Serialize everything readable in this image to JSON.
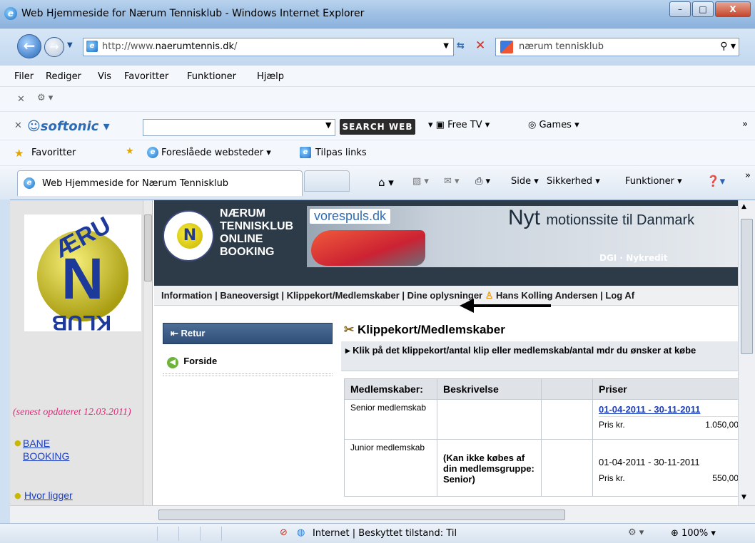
{
  "window": {
    "title": "Web Hjemmeside for Nærum Tennisklub - Windows Internet Explorer",
    "min": "–",
    "max": "□",
    "close": "X"
  },
  "address": {
    "prefix": "http://www.",
    "domain": "naerumtennis.dk",
    "suffix": "/",
    "search": "nærum tennisklub"
  },
  "menu": [
    "Filer",
    "Rediger",
    "Vis",
    "Favoritter",
    "Funktioner",
    "Hjælp"
  ],
  "softonic": {
    "logo": "softonic",
    "search_web": "SEARCH WEB",
    "free_tv": "Free TV",
    "games": "Games"
  },
  "favorites": {
    "fav": "Favoritter",
    "suggested": "Foreslåede websteder ▾",
    "custom": "Tilpas links"
  },
  "tab": {
    "title": "Web Hjemmeside for Nærum Tennisklub"
  },
  "cmdbar": {
    "side": "Side ▾",
    "security": "Sikkerhed ▾",
    "tools": "Funktioner ▾"
  },
  "left": {
    "updated": "(senest opdateret 12.03.2011)",
    "link1": "BANE BOOKING",
    "link2": "Hvor ligger"
  },
  "banner": {
    "title_lines": [
      "NÆRUM",
      "TENNISKLUB",
      "ONLINE",
      "BOOKING"
    ],
    "ad_link": "vorespuls.dk",
    "ad_big": "Nyt",
    "ad_rest": "motionssite til Danmark",
    "ad_foot": "DGI · Nykredit"
  },
  "nav": {
    "text": "Information | Baneoversigt | Klippekort/Medlemskaber | Dine oplysninger",
    "user": "Hans Kolling Andersen | Log Af"
  },
  "side": {
    "retur": "Retur",
    "forside": "Forside"
  },
  "section": {
    "title": "Klippekort/Medlemskaber",
    "instruction": "Klik på det klippekort/antal klip eller medlemskab/antal mdr du ønsker at købe"
  },
  "table": {
    "headers": [
      "Medlemskaber:",
      "Beskrivelse",
      "",
      "Priser"
    ],
    "rows": [
      {
        "name": "Senior medlemskab",
        "desc": "",
        "period": "01-04-2011 - 30-11-2011",
        "price_label": "Pris kr.",
        "price": "1.050,00"
      },
      {
        "name": "Junior medlemskab",
        "desc": "(Kan ikke købes af din medlemsgruppe: Senior)",
        "period": "01-04-2011 - 30-11-2011",
        "price_label": "Pris kr.",
        "price": "550,00"
      }
    ]
  },
  "status": {
    "zone": "Internet | Beskyttet tilstand: Til",
    "zoom": "100%"
  }
}
